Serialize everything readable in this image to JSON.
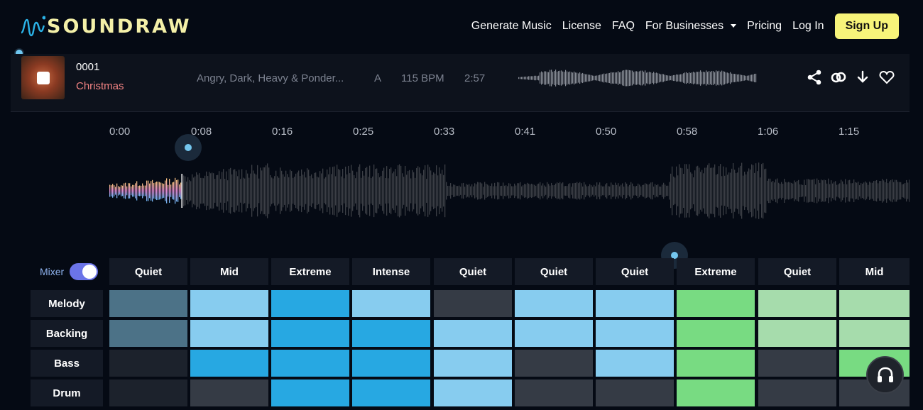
{
  "nav": {
    "logo_text": "SOUNDRAW",
    "links": [
      "Generate Music",
      "License",
      "FAQ",
      "For Businesses",
      "Pricing",
      "Log In"
    ],
    "signup": "Sign Up"
  },
  "track": {
    "number": "0001",
    "name": "Christmas",
    "tags": "Angry, Dark, Heavy & Ponder...",
    "key": "A",
    "bpm": "115 BPM",
    "length": "2:57",
    "actions": [
      "share-icon",
      "link-icon",
      "download-icon",
      "heart-icon"
    ]
  },
  "timeline": {
    "times": [
      "0:00",
      "0:08",
      "0:16",
      "0:25",
      "0:33",
      "0:41",
      "0:50",
      "0:58",
      "1:06",
      "1:15"
    ],
    "played_fraction": 0.09
  },
  "mixer": {
    "label": "Mixer",
    "toggle_on": true,
    "segments": [
      "Quiet",
      "Mid",
      "Extreme",
      "Intense",
      "Quiet",
      "Quiet",
      "Quiet",
      "Extreme",
      "Quiet",
      "Mid"
    ],
    "rows": [
      {
        "label": "Melody",
        "levels": [
          "low",
          "med",
          "high",
          "med",
          "off",
          "med",
          "med",
          "g-high",
          "g-med",
          "g-med"
        ]
      },
      {
        "label": "Backing",
        "levels": [
          "low",
          "med",
          "high",
          "high",
          "med",
          "med",
          "med",
          "g-high",
          "g-med",
          "g-med"
        ]
      },
      {
        "label": "Bass",
        "levels": [
          "off2",
          "high",
          "high",
          "high",
          "med",
          "off",
          "med",
          "g-high",
          "off",
          "g-high"
        ]
      },
      {
        "label": "Drum",
        "levels": [
          "off2",
          "off",
          "high",
          "high",
          "med",
          "off",
          "off",
          "g-high",
          "off",
          "off"
        ]
      }
    ],
    "colors": {
      "low": "#4c7287",
      "med": "#87ccef",
      "high": "#27a8e2",
      "off": "#353b45",
      "off2": "#1c222c",
      "g-high": "#78db82",
      "g-med": "#a6dcac"
    }
  },
  "support_icon": "headset-icon"
}
